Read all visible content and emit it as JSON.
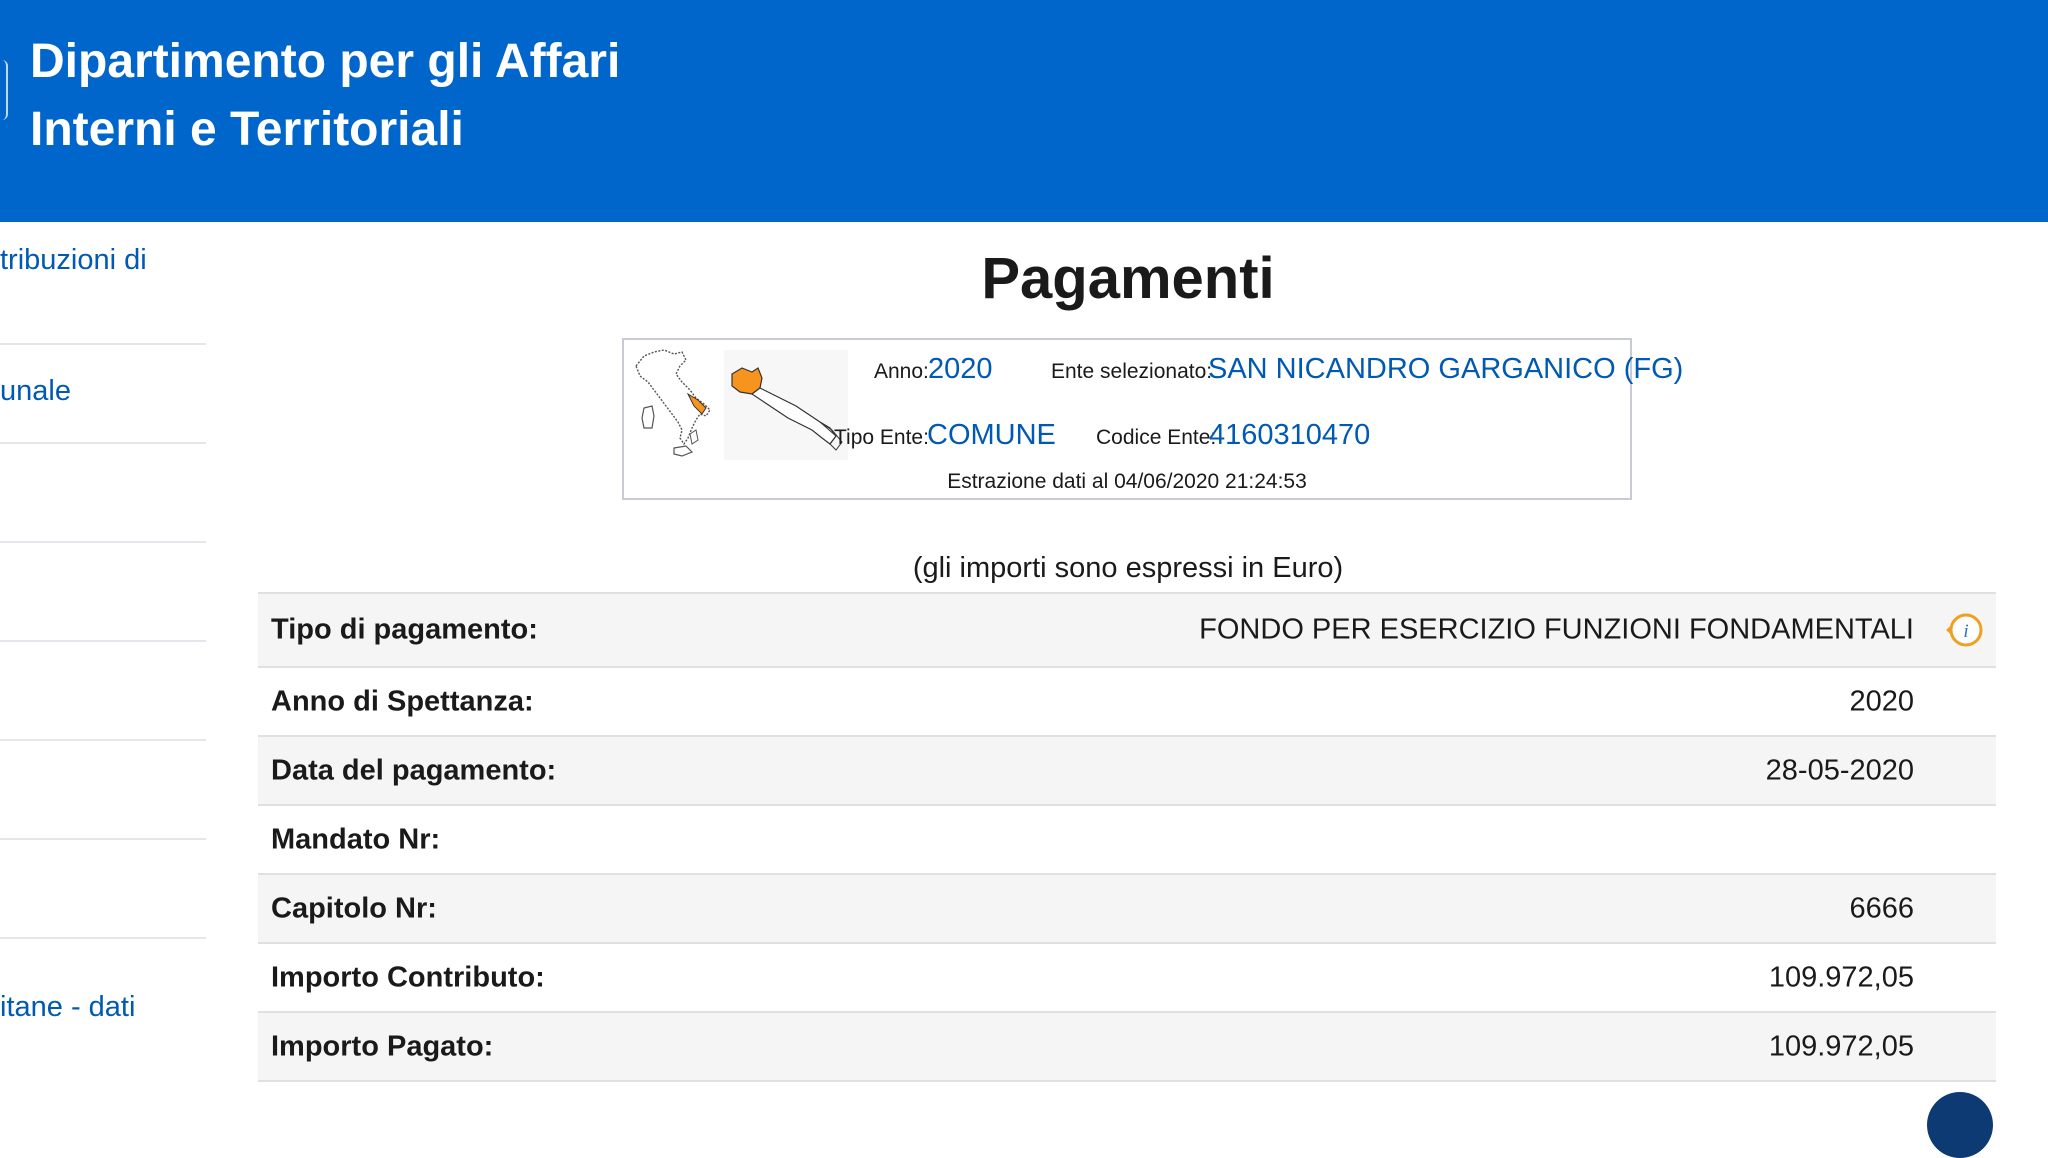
{
  "header": {
    "title_line1": "Dipartimento per gli Affari",
    "title_line2": "Interni e Territoriali"
  },
  "sidebar": {
    "items": [
      {
        "label": "tribuzioni di"
      },
      {
        "label": "unale"
      },
      {
        "label": ""
      },
      {
        "label": ""
      },
      {
        "label": ""
      },
      {
        "label": ""
      },
      {
        "label": ""
      },
      {
        "label": "itane - dati"
      }
    ]
  },
  "page": {
    "title": "Pagamenti",
    "currency_note": "(gli importi sono espressi in Euro)"
  },
  "info": {
    "anno_label": "Anno:",
    "anno_value": "2020",
    "ente_label": "Ente selezionato:",
    "ente_value": "SAN NICANDRO GARGANICO (FG)",
    "tipo_label": "Tipo Ente:",
    "tipo_value": "COMUNE",
    "codice_label": "Codice Ente:",
    "codice_value": "4160310470",
    "estrazione": "Estrazione dati al 04/06/2020 21:24:53"
  },
  "table": {
    "rows": [
      {
        "label": "Tipo di pagamento:",
        "value": "FONDO PER ESERCIZIO FUNZIONI FONDAMENTALI"
      },
      {
        "label": "Anno di Spettanza:",
        "value": "2020"
      },
      {
        "label": "Data del pagamento:",
        "value": "28-05-2020"
      },
      {
        "label": "Mandato Nr:",
        "value": ""
      },
      {
        "label": "Capitolo Nr:",
        "value": "6666"
      },
      {
        "label": "Importo Contributo:",
        "value": "109.972,05"
      },
      {
        "label": "Importo Pagato:",
        "value": "109.972,05"
      }
    ]
  },
  "colors": {
    "header_bg": "#0066cc",
    "link": "#0059b3",
    "region_highlight": "#f7941d",
    "info_icon": "#f0a020"
  },
  "icons": {
    "info": "info-icon",
    "map": "italy-map-icon",
    "region": "region-map-icon",
    "back_to_top": "back-to-top-icon"
  }
}
